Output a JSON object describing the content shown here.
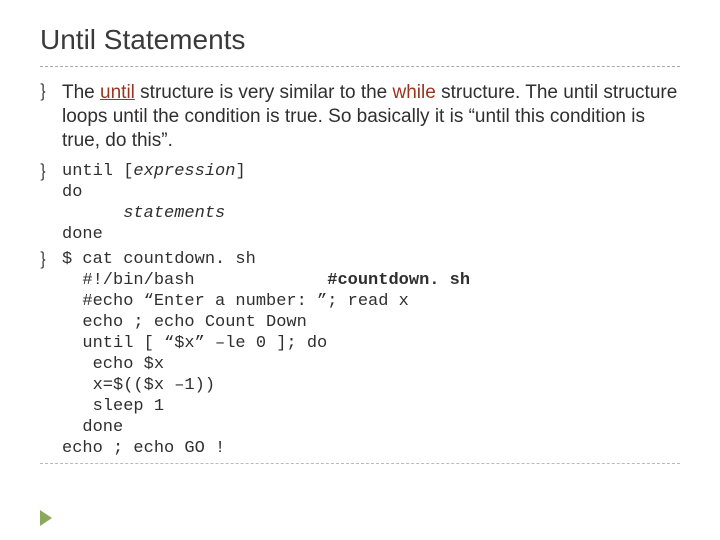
{
  "title": "Until Statements",
  "bullet_glyph": "｝",
  "para": {
    "t1": "The ",
    "kw1": "until",
    "t2": " structure is very similar to the ",
    "kw2": "while",
    "t3": " structure. The until structure loops until the condition is true. So basically it is “until this condition is true, do this”."
  },
  "code1": {
    "l1a": "until [",
    "l1b": "expression",
    "l1c": "]",
    "l2": "do",
    "l3": "      statements",
    "l4": "done"
  },
  "code2": {
    "l1": "$ cat countdown. sh",
    "l2a": "  #!/bin/bash             ",
    "l2b": "#countdown. sh",
    "l3": "  #echo “Enter a number: ”; read x",
    "l4": "  echo ; echo Count Down",
    "l5": "  until [ “$x” –le 0 ]; do",
    "l6": "   echo $x",
    "l7": "   x=$(($x –1))",
    "l8": "   sleep 1",
    "l9": "  done",
    "l10": "echo ; echo GO !"
  }
}
